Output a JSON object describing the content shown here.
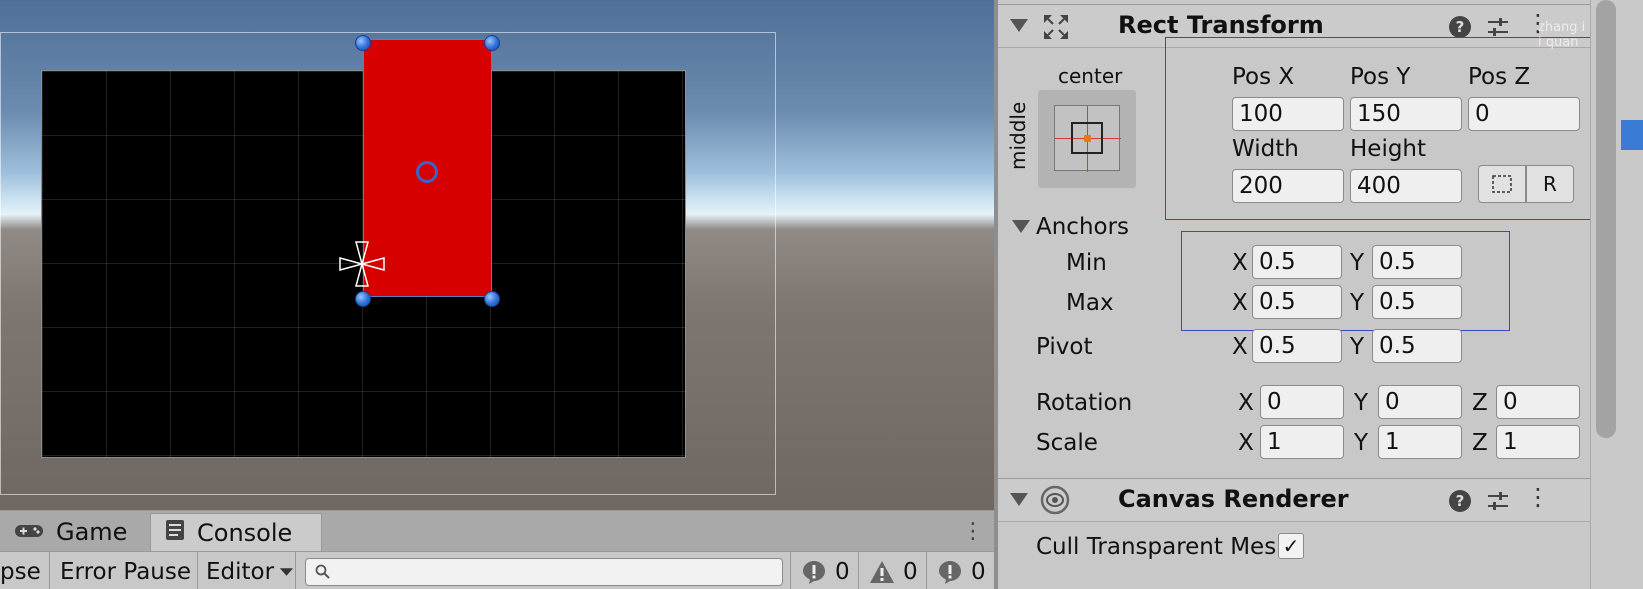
{
  "scene": {
    "colors": {
      "panel": "#000000",
      "red_rect": "#d70000",
      "handle": "#2b6fd6"
    }
  },
  "console": {
    "tabs": [
      {
        "label": "Game",
        "icon": "gamepad-icon"
      },
      {
        "label": "Console",
        "icon": "console-log-icon"
      }
    ],
    "toolbar": {
      "collapse": "pse",
      "error_pause": "Error Pause",
      "editor": "Editor",
      "search_placeholder": ""
    },
    "counts": {
      "info": "0",
      "warnings": "0",
      "errors": "0"
    }
  },
  "inspector": {
    "rect_transform": {
      "title": "Rect Transform",
      "preset_top": "center",
      "preset_side": "middle",
      "pos_x_label": "Pos X",
      "pos_y_label": "Pos Y",
      "pos_z_label": "Pos Z",
      "pos_x": "100",
      "pos_y": "150",
      "pos_z": "0",
      "width_label": "Width",
      "height_label": "Height",
      "width": "200",
      "height": "400",
      "raw_edit_button": "R",
      "anchors_label": "Anchors",
      "min_label": "Min",
      "max_label": "Max",
      "min_x": "0.5",
      "min_y": "0.5",
      "max_x": "0.5",
      "max_y": "0.5",
      "pivot_label": "Pivot",
      "pivot_x": "0.5",
      "pivot_y": "0.5",
      "rotation_label": "Rotation",
      "rot_x": "0",
      "rot_y": "0",
      "rot_z": "0",
      "scale_label": "Scale",
      "scale_x": "1",
      "scale_y": "1",
      "scale_z": "1",
      "axis_x": "X",
      "axis_y": "Y",
      "axis_z": "Z"
    },
    "canvas_renderer": {
      "title": "Canvas Renderer",
      "cull_label": "Cull Transparent Mes",
      "cull_checked": "✓"
    },
    "watermark": "zhang i i quan"
  }
}
